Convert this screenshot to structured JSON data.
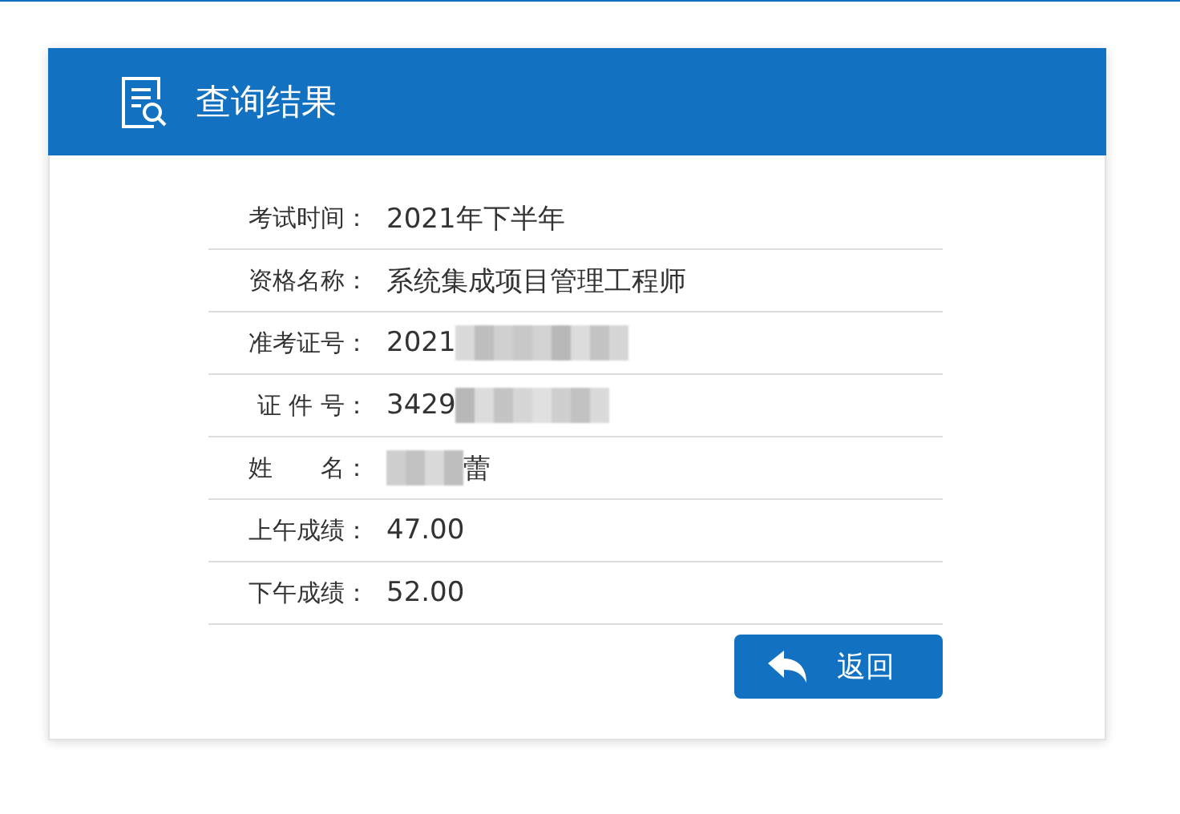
{
  "header": {
    "title": "查询结果"
  },
  "rows": [
    {
      "label": "考试时间：",
      "value": [
        {
          "kind": "text",
          "text": "2021年下半年"
        }
      ]
    },
    {
      "label": "资格名称：",
      "value": [
        {
          "kind": "text",
          "text": "系统集成项目管理工程师"
        }
      ]
    },
    {
      "label": "准考证号：",
      "value": [
        {
          "kind": "text",
          "text": "2021"
        },
        {
          "kind": "blur"
        }
      ]
    },
    {
      "label": "证 件 号：",
      "value": [
        {
          "kind": "text",
          "text": "3429"
        },
        {
          "kind": "blur"
        }
      ]
    },
    {
      "label": "姓　　名：",
      "value": [
        {
          "kind": "blur"
        },
        {
          "kind": "text",
          "text": "蕾"
        }
      ]
    },
    {
      "label": "上午成绩：",
      "value": [
        {
          "kind": "text",
          "text": "47.00"
        }
      ]
    },
    {
      "label": "下午成绩：",
      "value": [
        {
          "kind": "text",
          "text": "52.00"
        }
      ]
    }
  ],
  "button": {
    "label": "返回"
  }
}
